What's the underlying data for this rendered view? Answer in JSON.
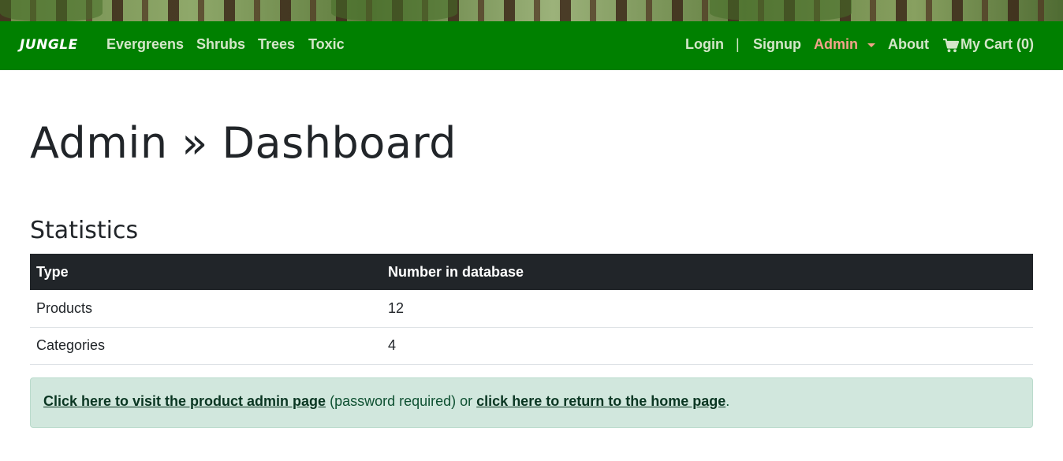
{
  "navbar": {
    "brand": "JUNGLE",
    "left_links": [
      "Evergreens",
      "Shrubs",
      "Trees",
      "Toxic"
    ],
    "login": "Login",
    "separator": "|",
    "signup": "Signup",
    "admin": "Admin",
    "about": "About",
    "cart": "My Cart (0)",
    "cart_icon": "shopping-cart-icon",
    "colors": {
      "bar": "#008000",
      "link": "#d4e6c9",
      "admin": "#f4a38b"
    }
  },
  "page": {
    "title": "Admin » Dashboard",
    "section_title": "Statistics"
  },
  "stats_table": {
    "headers": [
      "Type",
      "Number in database"
    ],
    "rows": [
      [
        "Products",
        "12"
      ],
      [
        "Categories",
        "4"
      ]
    ]
  },
  "alert": {
    "product_admin_link": "Click here to visit the product admin page",
    "middle_text": " (password required) or ",
    "home_link": "click here to return to the home page",
    "end_text": ".",
    "color": "#d1e7dd"
  }
}
